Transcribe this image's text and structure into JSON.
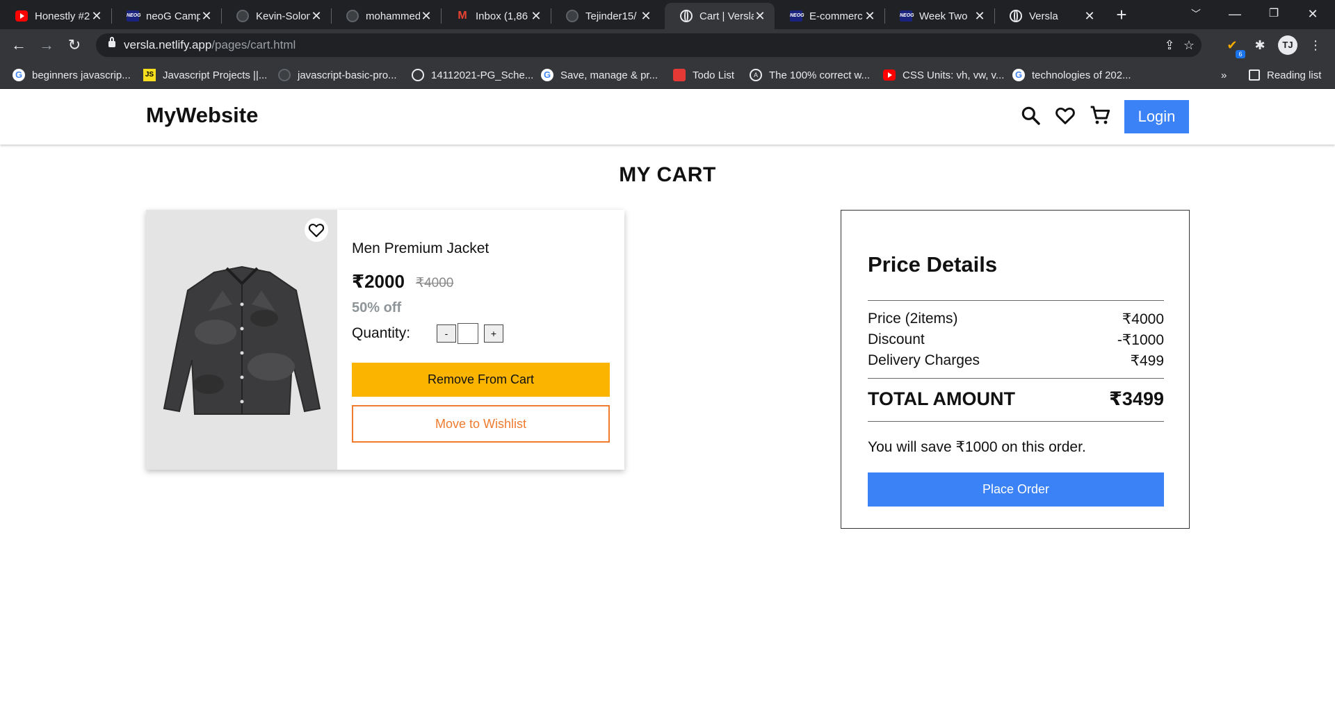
{
  "browser": {
    "tabs": [
      {
        "title": "Honestly #2",
        "icon": "youtube-icon"
      },
      {
        "title": "neoG Camp",
        "icon": "neog-icon"
      },
      {
        "title": "Kevin-Solon",
        "icon": "github-icon"
      },
      {
        "title": "mohammed",
        "icon": "github-icon"
      },
      {
        "title": "Inbox (1,86",
        "icon": "gmail-icon"
      },
      {
        "title": "Tejinder15/",
        "icon": "github-icon"
      },
      {
        "title": "Cart | Versla",
        "icon": "globe-icon",
        "active": true
      },
      {
        "title": "E-commerc",
        "icon": "neog-icon"
      },
      {
        "title": "Week Two",
        "icon": "neog-icon"
      },
      {
        "title": "Versla",
        "icon": "globe-icon"
      }
    ],
    "new_tab": "+",
    "url_host": "versla.netlify.app",
    "url_path": "/pages/cart.html",
    "extension_badge": "6",
    "profile_initials": "TJ",
    "bookmarks": [
      {
        "label": "beginners javascrip...",
        "icon": "google-icon"
      },
      {
        "label": "Javascript Projects ||...",
        "icon": "js-icon"
      },
      {
        "label": "javascript-basic-pro...",
        "icon": "github-icon"
      },
      {
        "label": "14112021-PG_Sche...",
        "icon": "globe-icon"
      },
      {
        "label": "Save, manage & pr...",
        "icon": "google-icon"
      },
      {
        "label": "Todo List",
        "icon": "todo-icon"
      },
      {
        "label": "The 100% correct w...",
        "icon": "a-icon"
      },
      {
        "label": "CSS Units: vh, vw, v...",
        "icon": "youtube-icon"
      },
      {
        "label": "technologies of 202...",
        "icon": "google-icon"
      }
    ],
    "more_bookmarks": "»",
    "reading_list": "Reading list"
  },
  "site": {
    "brand": "MyWebsite",
    "login_label": "Login"
  },
  "cart": {
    "title": "MY CART",
    "item": {
      "name": "Men Premium Jacket",
      "price": "₹2000",
      "original_price": "₹4000",
      "discount": "50% off",
      "quantity_label": "Quantity:",
      "quantity_value": "",
      "minus": "-",
      "plus": "+",
      "remove_label": "Remove From Cart",
      "wishlist_label": "Move to Wishlist"
    }
  },
  "price_details": {
    "title": "Price Details",
    "rows": [
      {
        "label": "Price (2items)",
        "value": "₹4000"
      },
      {
        "label": "Discount",
        "value": "-₹1000"
      },
      {
        "label": "Delivery Charges",
        "value": "₹499"
      }
    ],
    "total_label": "TOTAL AMOUNT",
    "total_value": "₹3499",
    "savings_note": "You will save ₹1000 on this order.",
    "order_label": "Place Order"
  },
  "colors": {
    "brand_blue": "#3b82f6",
    "remove_yellow": "#fbb400",
    "wishlist_orange": "#f07a2e"
  }
}
